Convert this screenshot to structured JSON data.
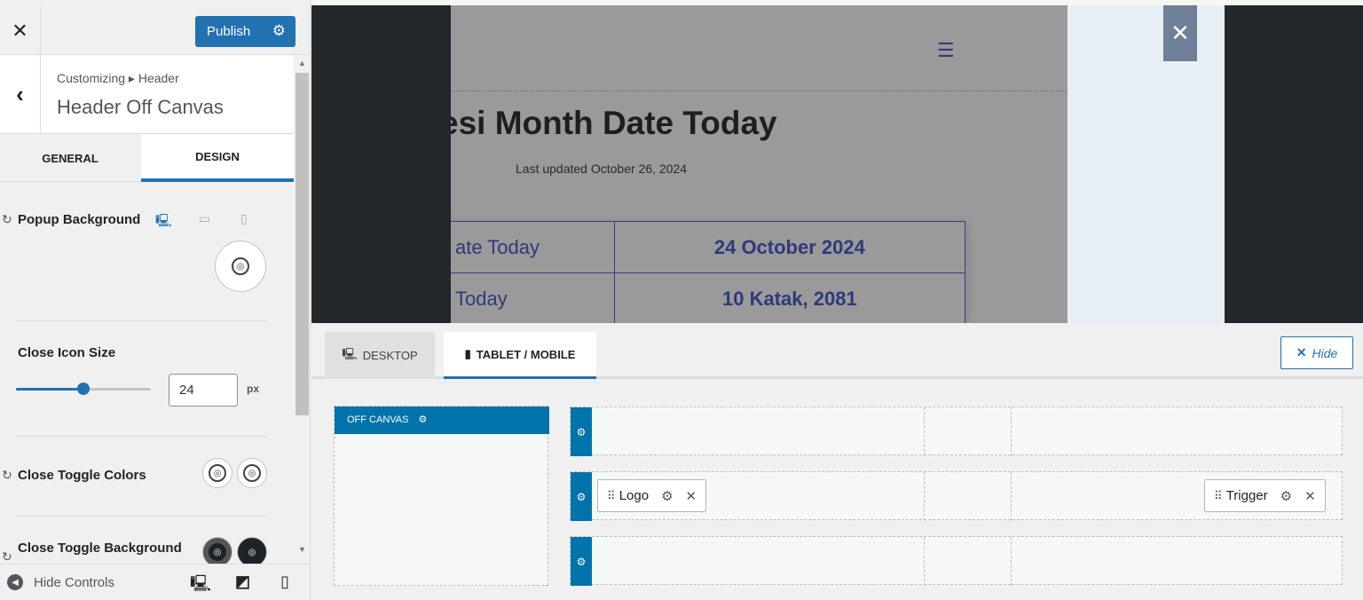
{
  "topbar": {
    "close": "✕",
    "publish_label": "Publish"
  },
  "section": {
    "breadcrumb": "Customizing ▸ Header",
    "title": "Header Off Canvas"
  },
  "tabs": {
    "general": "GENERAL",
    "design": "DESIGN"
  },
  "controls": {
    "popup_background": "Popup Background",
    "close_icon_size": "Close Icon Size",
    "close_icon_size_value": "24",
    "close_icon_size_unit": "px",
    "close_icon_slider_percent": 50,
    "close_toggle_colors": "Close Toggle Colors",
    "close_toggle_background": "Close Toggle Background"
  },
  "footer": {
    "hide_controls": "Hide Controls"
  },
  "preview": {
    "heading": "esi Month Date Today",
    "updated": "Last updated October 26, 2024",
    "table": [
      {
        "key": "ate Today",
        "value": "24 October 2024"
      },
      {
        "key": "Today",
        "value": "10 Katak, 2081"
      }
    ]
  },
  "builder": {
    "tab_desktop": "DESKTOP",
    "tab_mobile": "TABLET / MOBILE",
    "hide_label": "Hide",
    "off_canvas_label": "OFF CANVAS",
    "logo_label": "Logo",
    "trigger_label": "Trigger"
  },
  "colors": {
    "accent": "#2271b1",
    "builder_blue": "#0073aa"
  }
}
